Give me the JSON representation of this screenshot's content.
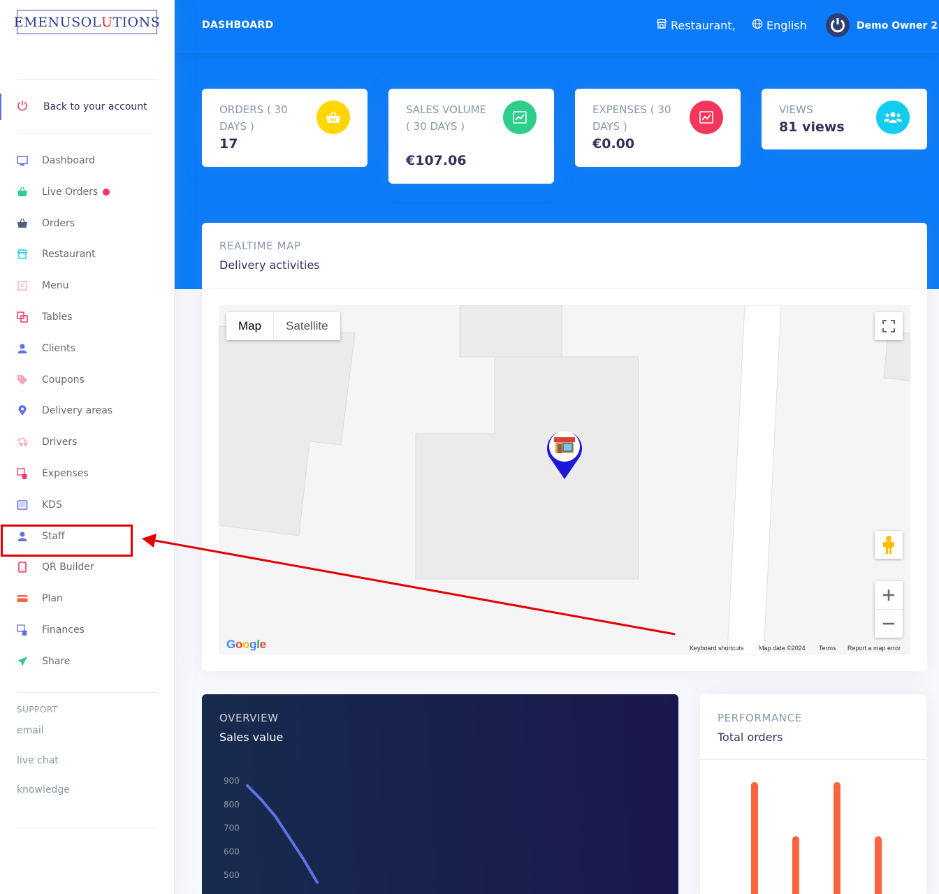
{
  "sidebar": {
    "logo": {
      "pre": "EMENUSOL",
      "mid": "U",
      "post": "TIONS"
    },
    "back_label": "Back to your account",
    "items": [
      {
        "label": "Dashboard",
        "icon": "monitor-icon",
        "color": "#5e72e4"
      },
      {
        "label": "Live Orders",
        "icon": "basket-icon",
        "color": "#2dce89",
        "has_dot": true
      },
      {
        "label": "Orders",
        "icon": "basket-icon",
        "color": "#525f7f"
      },
      {
        "label": "Restaurant",
        "icon": "shop-icon",
        "color": "#11cdef"
      },
      {
        "label": "Menu",
        "icon": "book-icon",
        "color": "#f3a4b5"
      },
      {
        "label": "Tables",
        "icon": "tables-icon",
        "color": "#f5365c"
      },
      {
        "label": "Clients",
        "icon": "user-icon",
        "color": "#5e72e4"
      },
      {
        "label": "Coupons",
        "icon": "tag-icon",
        "color": "#f3a4b5"
      },
      {
        "label": "Delivery areas",
        "icon": "pin-icon",
        "color": "#5e72e4"
      },
      {
        "label": "Drivers",
        "icon": "delivery-icon",
        "color": "#f3a4b5"
      },
      {
        "label": "Expenses",
        "icon": "money-icon",
        "color": "#f5365c"
      },
      {
        "label": "KDS",
        "icon": "tablet-icon",
        "color": "#5e72e4"
      },
      {
        "label": "Staff",
        "icon": "user-icon",
        "color": "#5e72e4"
      },
      {
        "label": "QR Builder",
        "icon": "mobile-icon",
        "color": "#f5365c"
      },
      {
        "label": "Plan",
        "icon": "card-icon",
        "color": "#fb6340"
      },
      {
        "label": "Finances",
        "icon": "money-icon",
        "color": "#5e72e4"
      },
      {
        "label": "Share",
        "icon": "send-icon",
        "color": "#2dce89"
      }
    ],
    "support": {
      "heading": "SUPPORT",
      "links": [
        "email",
        "live chat",
        "knowledge"
      ]
    }
  },
  "header": {
    "title": "DASHBOARD",
    "restaurant_label": "Restaurant,",
    "language_label": "English",
    "user_name": "Demo Owner 2"
  },
  "stats": [
    {
      "title": "ORDERS ( 30 DAYS )",
      "value": "17",
      "icon": "basket-icon",
      "color": "#ffd600"
    },
    {
      "title": "SALES VOLUME ( 30 DAYS )",
      "value": "€107.06",
      "icon": "chart-icon",
      "color": "#2dce89"
    },
    {
      "title": "EXPENSES ( 30 DAYS )",
      "value": "€0.00",
      "icon": "chart-icon",
      "color": "#f5365c"
    },
    {
      "title": "VIEWS",
      "value": "81 views",
      "icon": "users-icon",
      "color": "#11cdef"
    }
  ],
  "map": {
    "title": "REALTIME MAP",
    "subtitle": "Delivery activities",
    "type_map": "Map",
    "type_satellite": "Satellite",
    "google": "Google",
    "attribution": [
      "Keyboard shortcuts",
      "Map data ©2024",
      "Terms",
      "Report a map error"
    ]
  },
  "overview": {
    "title": "OVERVIEW",
    "subtitle": "Sales value"
  },
  "performance": {
    "title": "PERFORMANCE",
    "subtitle": "Total orders"
  },
  "chart_data": [
    {
      "type": "line",
      "title": "Sales value",
      "y_ticks": [
        900,
        800,
        700,
        600,
        500
      ],
      "ylim": [
        400,
        900
      ],
      "series": [
        {
          "values": [
            880,
            820,
            750,
            660,
            570,
            470
          ]
        }
      ],
      "grid": false,
      "color": "#5e72e4"
    },
    {
      "type": "bar",
      "title": "Total orders",
      "values": [
        9,
        5,
        9,
        5
      ],
      "ylim": [
        0,
        10
      ],
      "grid": false,
      "color": "#fb6340"
    }
  ]
}
